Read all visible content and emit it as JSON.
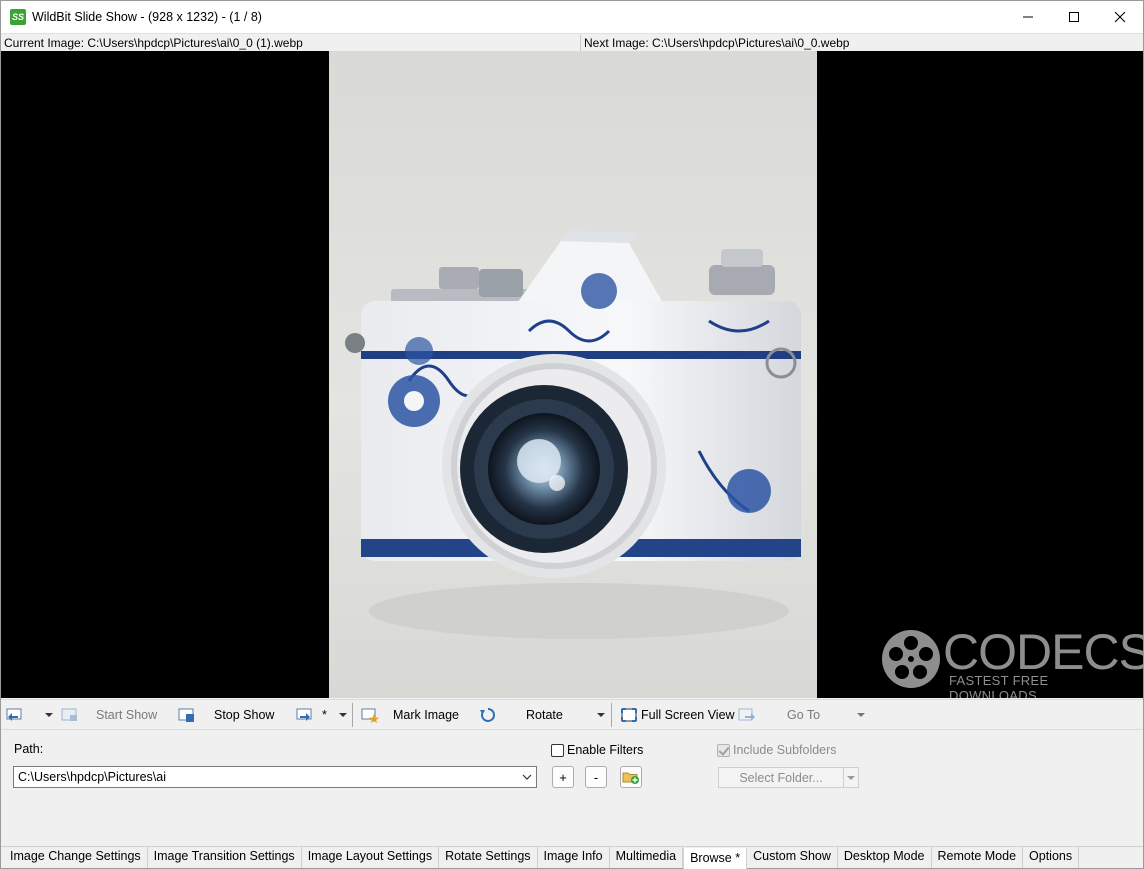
{
  "titlebar": {
    "app_icon_text": "SS",
    "title": "WildBit Slide Show - (928 x 1232) - (1 / 8)",
    "icons": [
      "minimize-icon",
      "maximize-icon",
      "close-icon"
    ]
  },
  "infobar": {
    "current_image": "Current Image: C:\\Users\\hpdcp\\Pictures\\ai\\0_0 (1).webp",
    "next_image": "Next Image: C:\\Users\\hpdcp\\Pictures\\ai\\0_0.webp"
  },
  "watermark": {
    "brand": "CODECS",
    "tagline": "FASTEST FREE DOWNLOADS"
  },
  "toolbar": {
    "start_show": "Start Show",
    "stop_show": "Stop Show",
    "star_label": "*",
    "mark_image": "Mark Image",
    "rotate": "Rotate",
    "full_screen_view": "Full Screen View",
    "go_to": "Go To"
  },
  "panel": {
    "path_label": "Path:",
    "path_value": "C:\\Users\\hpdcp\\Pictures\\ai",
    "add_btn": "+",
    "remove_btn": "-",
    "enable_filters": "Enable Filters",
    "include_subfolders": "Include Subfolders",
    "select_folder": "Select Folder..."
  },
  "tabs": [
    {
      "label": "Image Change Settings",
      "active": false
    },
    {
      "label": "Image Transition Settings",
      "active": false
    },
    {
      "label": "Image Layout Settings",
      "active": false
    },
    {
      "label": "Rotate Settings",
      "active": false
    },
    {
      "label": "Image Info",
      "active": false
    },
    {
      "label": "Multimedia",
      "active": false
    },
    {
      "label": "Browse *",
      "active": true
    },
    {
      "label": "Custom Show",
      "active": false
    },
    {
      "label": "Desktop Mode",
      "active": false
    },
    {
      "label": "Remote Mode",
      "active": false
    },
    {
      "label": "Options",
      "active": false
    }
  ],
  "colors": {
    "app_icon": "#3aa335",
    "viewer_bg": "#000000",
    "accent_blue": "#1f5fbf"
  }
}
